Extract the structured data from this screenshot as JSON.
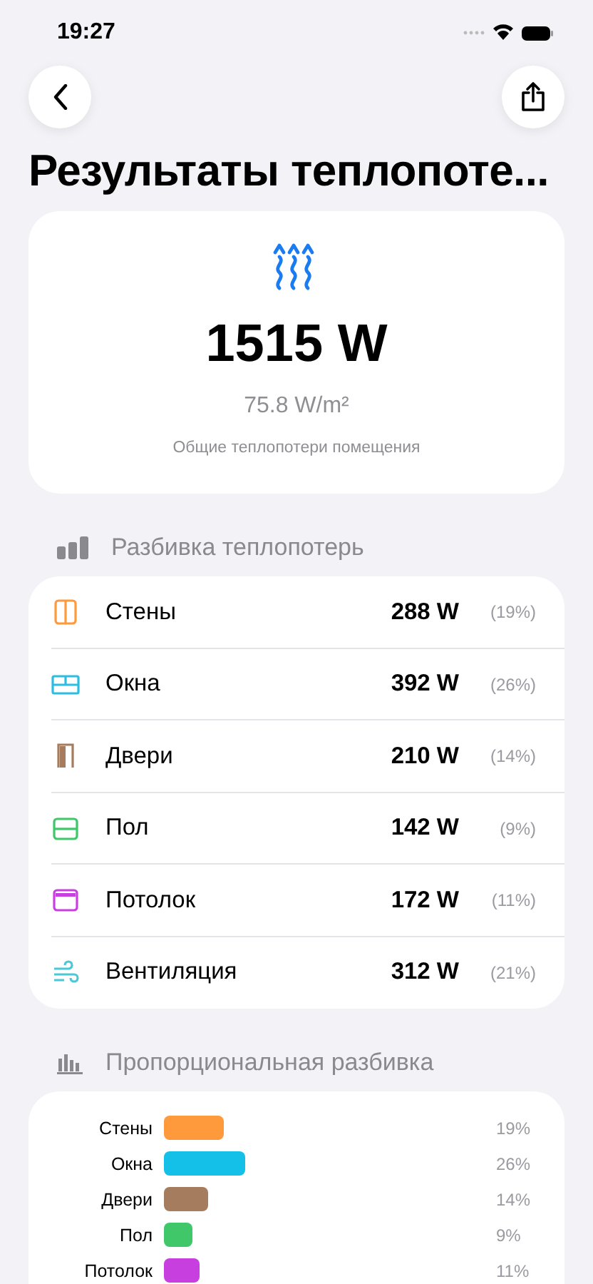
{
  "status_bar": {
    "time": "19:27"
  },
  "title": "Результаты теплопоте...",
  "summary": {
    "total": "1515 W",
    "per_area": "75.8 W/m²",
    "caption": "Общие теплопотери помещения"
  },
  "breakdown": {
    "header": "Разбивка теплопотерь",
    "items": [
      {
        "name": "Стены",
        "value": "288 W",
        "percent": "(19%)",
        "color": "#ff9a3c"
      },
      {
        "name": "Окна",
        "value": "392 W",
        "percent": "(26%)",
        "color": "#2cbde0"
      },
      {
        "name": "Двери",
        "value": "210 W",
        "percent": "(14%)",
        "color": "#a67c5e"
      },
      {
        "name": "Пол",
        "value": "142 W",
        "percent": "(9%)",
        "color": "#3fc76a"
      },
      {
        "name": "Потолок",
        "value": "172 W",
        "percent": "(11%)",
        "color": "#c83fe0"
      },
      {
        "name": "Вентиляция",
        "value": "312 W",
        "percent": "(21%)",
        "color": "#4cc7d6"
      }
    ]
  },
  "proportional": {
    "header": "Пропорциональная разбивка",
    "bars": [
      {
        "name": "Стены",
        "percent": "19%",
        "color": "#ff9a3c"
      },
      {
        "name": "Окна",
        "percent": "26%",
        "color": "#14c0e8"
      },
      {
        "name": "Двери",
        "percent": "14%",
        "color": "#a67c5e"
      },
      {
        "name": "Пол",
        "percent": "9%",
        "color": "#3fc76a"
      },
      {
        "name": "Потолок",
        "percent": "11%",
        "color": "#c83fe0"
      }
    ]
  }
}
